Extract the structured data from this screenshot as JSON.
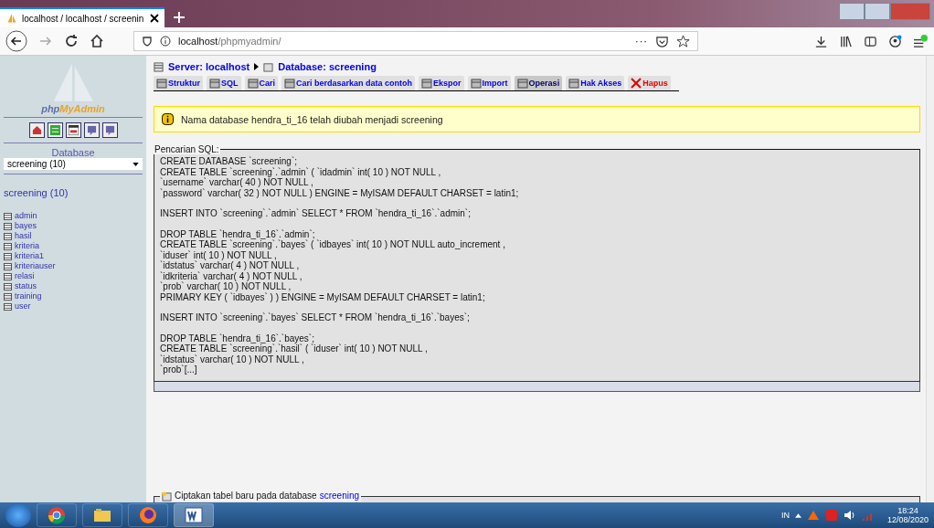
{
  "browser": {
    "tab_title": "localhost / localhost / screenin",
    "url_host": "localhost",
    "url_path": "/phpmyadmin/",
    "menu_dots": "···"
  },
  "sidebar": {
    "logo_php": "php",
    "logo_my": "MyAdmin",
    "db_label": "Database",
    "db_select": "screening (10)",
    "db_heading": "screening (10)",
    "tables": [
      "admin",
      "bayes",
      "hasil",
      "kriteria",
      "kriteria1",
      "kriteriauser",
      "relasi",
      "status",
      "training",
      "user"
    ]
  },
  "breadcrumb": {
    "server": "Server: localhost",
    "database": "Database: screening"
  },
  "tabs": [
    {
      "label": "Struktur",
      "selected": false,
      "kind": "normal"
    },
    {
      "label": "SQL",
      "selected": false,
      "kind": "normal"
    },
    {
      "label": "Cari",
      "selected": false,
      "kind": "normal"
    },
    {
      "label": "Cari berdasarkan data contoh",
      "selected": false,
      "kind": "normal"
    },
    {
      "label": "Ekspor",
      "selected": false,
      "kind": "normal"
    },
    {
      "label": "Import",
      "selected": false,
      "kind": "normal"
    },
    {
      "label": "Operasi",
      "selected": true,
      "kind": "normal"
    },
    {
      "label": "Hak Akses",
      "selected": false,
      "kind": "normal"
    },
    {
      "label": "Hapus",
      "selected": false,
      "kind": "danger"
    }
  ],
  "notice": "Nama database hendra_ti_16 telah diubah menjadi screening",
  "sql_box": {
    "legend": "Pencarian SQL:",
    "blocks": [
      [
        "CREATE DATABASE `screening`;",
        "CREATE TABLE `screening`.`admin` ( `idadmin` int( 10 ) NOT NULL ,",
        "`username` varchar( 40 ) NOT NULL ,",
        "`password` varchar( 32 ) NOT NULL ) ENGINE = MyISAM DEFAULT CHARSET = latin1;"
      ],
      [
        "INSERT INTO `screening`.`admin` SELECT * FROM `hendra_ti_16`.`admin`;"
      ],
      [
        "DROP TABLE `hendra_ti_16`.`admin`;",
        "CREATE TABLE `screening`.`bayes` ( `idbayes` int( 10 ) NOT NULL auto_increment ,",
        "`iduser` int( 10 ) NOT NULL ,",
        "`idstatus` varchar( 4 ) NOT NULL ,",
        "`idkriteria` varchar( 4 ) NOT NULL ,",
        "`prob` varchar( 10 ) NOT NULL ,",
        "PRIMARY KEY ( `idbayes` ) ) ENGINE = MyISAM DEFAULT CHARSET = latin1;"
      ],
      [
        "INSERT INTO `screening`.`bayes` SELECT * FROM `hendra_ti_16`.`bayes`;"
      ],
      [
        "DROP TABLE `hendra_ti_16`.`bayes`;",
        "CREATE TABLE `screening`.`hasil` ( `iduser` int( 10 ) NOT NULL ,",
        "`idstatus` varchar( 10 ) NOT NULL ,",
        "`prob`[...]"
      ]
    ]
  },
  "create_table": {
    "legend": "Ciptakan tabel baru pada database",
    "db_link": "screening"
  },
  "taskbar": {
    "lang": "IN",
    "time": "18:24",
    "date": "12/08/2020"
  }
}
